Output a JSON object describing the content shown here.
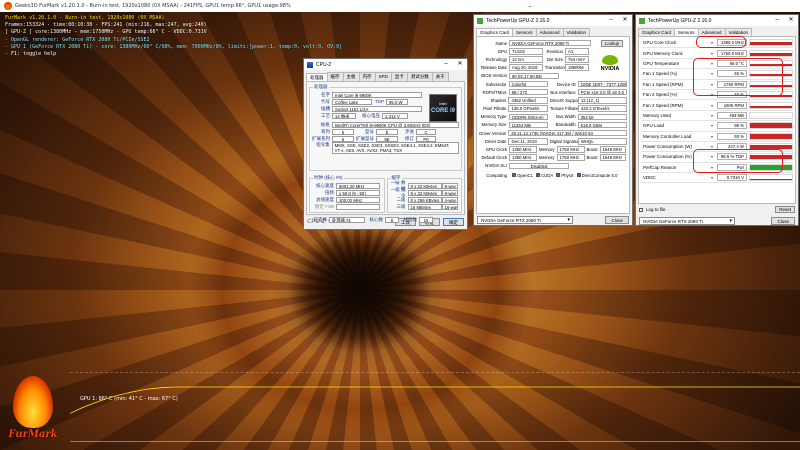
{
  "furmark": {
    "window_title": "Geeks3D FurMark v1.20.1.0 - Burn-in test, 1920x1080 (0X MSAA) - 241FPS, GPU1 temp:66°, GPU1 usage:98%",
    "overlay_line1": "FurMark v1.20.1.0 - Burn-in test, 1920x1080 (0X MSAA)",
    "overlay_line2": "Frames:153324 - time:00:10:38 - FPS:241 (min:216, max:247, avg:240)",
    "overlay_line3": "[ GPU-Z ] core:1380MHz - mem:1750MHz - GPU temp:66° C - VDDC:0.731V",
    "overlay_line4": "- OpenGL renderer: GeForce RTX 2080 Ti/PCIe/SSE2",
    "overlay_line5": "- GPU 1 (GeForce RTX 2080 Ti) - core: 1380MHz/66° C/98%, mem: 7000MHz/8%, limits:[power:1, temp:0, volt:0, OV:0]",
    "overlay_line6": "- F1: toggle help",
    "graph_label": "GPU 1: 66° C (min: 41° C - max: 67° C)",
    "logo_text": "FurMark",
    "temp_min": 41,
    "temp_max": 67,
    "temp_current": 66
  },
  "cpuz": {
    "title": "CPU-Z",
    "tabs": [
      "处理器",
      "缓存",
      "主板",
      "内存",
      "SPD",
      "显卡",
      "测试分数",
      "关于"
    ],
    "group_processor": "处理器",
    "name_label": "名字",
    "name_value": "Intel Core i9 9900K",
    "codename_label": "代号",
    "codename_value": "Coffee Lake",
    "tdp_label": "TDP",
    "tdp_value": "95.0 W",
    "package_label": "插槽",
    "package_value": "Socket 1151 LGA",
    "tech_label": "工艺",
    "tech_value": "14 纳米",
    "voltage_label": "核心电压",
    "voltage_value": "1.312 V",
    "spec_label": "规格",
    "spec_value": "Intel(R) Core(TM) i9-9900K CPU @ 3.60GHz (ES)",
    "family_label": "系列",
    "family_value": "6",
    "model_label": "型号",
    "model_value": "E",
    "stepping_label": "步进",
    "stepping_value": "C",
    "extfamily_label": "扩展系列",
    "extfamily_value": "6",
    "extmodel_label": "扩展型号",
    "extmodel_value": "9E",
    "revision_label": "修订",
    "revision_value": "P0",
    "instr_label": "指令集",
    "instr_value": "MMX, SSE, SSE2, SSE3, SSSE3, SSE4.1, SSE4.2, EM64T, VT-x, AES, AVX, AVX2, FMA3, TSX",
    "clocks_group": "时钟 (核心 #0)",
    "core_speed_label": "核心速度",
    "core_speed_value": "5001.20 MHz",
    "multiplier_label": "倍频",
    "multiplier_value": "x 50.0 (8 - 50)",
    "bus_label": "总线速度",
    "bus_value": "100.02 MHz",
    "fsb_label": "额定 FSB",
    "fsb_value": "",
    "cache_group": "缓存",
    "l1d_label": "一级 数据",
    "l1d_value": "8 x 32 KBytes",
    "l1d_way": "8-way",
    "l1i_label": "一级 指令",
    "l1i_value": "8 x 32 KBytes",
    "l1i_way": "8-way",
    "l2_label": "二级",
    "l2_value": "8 x 256 KBytes",
    "l2_way": "4-way",
    "l3_label": "三级",
    "l3_value": "16 MBytes",
    "l3_way": "16-way",
    "selection_label": "已选择",
    "selection_value": "处理器 #1",
    "cores_label": "核心数",
    "cores_value": "8",
    "threads_label": "线程数",
    "threads_value": "16",
    "brand": "CPU-Z",
    "version": "Ver. 1.87.0.x64",
    "tools_button": "工具",
    "validate_button": "验证",
    "ok_button": "确定",
    "intel_badge_top": "intel",
    "intel_badge_main": "CORE i9"
  },
  "gpuz1": {
    "title": "TechPowerUp GPU-Z 2.16.0",
    "tabs": [
      "Graphics Card",
      "Sensors",
      "Advanced",
      "Validation"
    ],
    "lookup_button": "Lookup",
    "nvidia_text": "NVIDIA",
    "rows": [
      {
        "label": "Name",
        "value": "NVIDIA GeForce RTX 2080 Ti"
      },
      {
        "label": "GPU",
        "value": "TU102",
        "label2": "Revision",
        "value2": "A1"
      },
      {
        "label": "Technology",
        "value": "12 nm",
        "label2": "Die Size",
        "value2": "754 mm²"
      },
      {
        "label": "Release Date",
        "value": "Aug 20, 2018",
        "label2": "Transistors",
        "value2": "18600M"
      },
      {
        "label": "BIOS Version",
        "value": "90.02.17.00.BD"
      },
      {
        "label": "Subvendor",
        "value": "Colorful",
        "label2": "Device ID",
        "value2": "10DE 1E07 - 7377 1208"
      },
      {
        "label": "ROPs/TMUs",
        "value": "88 / 272",
        "label2": "Bus Interface",
        "value2": "PCIe x16 3.0 @ x8 3.0"
      },
      {
        "label": "Shaders",
        "value": "4352 Unified",
        "label2": "DirectX Support",
        "value2": "12 (12_1)"
      },
      {
        "label": "Pixel Fillrate",
        "value": "136.0 GPixel/s",
        "label2": "Texture Fillrate",
        "value2": "420.2 GTexel/s"
      },
      {
        "label": "Memory Type",
        "value": "GDDR6 (Micron)",
        "label2": "Bus Width",
        "value2": "352 bit"
      },
      {
        "label": "Memory Size",
        "value": "11264 MB",
        "label2": "Bandwidth",
        "value2": "616.0 GB/s"
      },
      {
        "label": "Driver Version",
        "value": "25.21.14.1735 (NVIDIA 417.35) / Win10 64"
      },
      {
        "label": "Driver Date",
        "value": "Dec 11, 2018",
        "label2": "Digital Signature",
        "value2": "WHQL"
      },
      {
        "label": "GPU Clock",
        "value": "1350 MHz",
        "label2": "Memory",
        "value2": "1750 MHz",
        "label3": "Boost",
        "value3": "1545 MHz"
      },
      {
        "label": "Default Clock",
        "value": "1350 MHz",
        "label2": "Memory",
        "value2": "1750 MHz",
        "label3": "Boost",
        "value3": "1545 MHz"
      },
      {
        "label": "NVIDIA SLI",
        "value": "Disabled"
      }
    ],
    "computing_label": "Computing",
    "computing_items": [
      "OpenCL",
      "CUDA",
      "PhysX",
      "DirectCompute 5.0"
    ],
    "select_value": "NVIDIA GeForce RTX 2080 Ti",
    "close_button": "Close"
  },
  "gpuz2": {
    "title": "TechPowerUp GPU-Z 2.16.0",
    "tabs": [
      "Graphics Card",
      "Sensors",
      "Advanced",
      "Validation"
    ],
    "sensors": [
      {
        "label": "GPU Core Clock",
        "value": "1380.0 MHz",
        "level": 0.55
      },
      {
        "label": "GPU Memory Clock",
        "value": "1750.0 MHz",
        "level": 0.5
      },
      {
        "label": "GPU Temperature",
        "value": "66.0 °C",
        "level": 0.45
      },
      {
        "label": "Fan 1 Speed (%)",
        "value": "45 %",
        "level": 0.45
      },
      {
        "label": "Fan 1 Speed (RPM)",
        "value": "1750 RPM",
        "level": 0.45
      },
      {
        "label": "Fan 2 Speed (%)",
        "value": "46 %",
        "level": 0.45
      },
      {
        "label": "Fan 2 Speed (RPM)",
        "value": "1605 RPM",
        "level": 0.4
      },
      {
        "label": "Memory Used",
        "value": "493 MB",
        "level": 0.05
      },
      {
        "label": "GPU Load",
        "value": "98 %",
        "level": 0.98
      },
      {
        "label": "Memory Controller Load",
        "value": "93 %",
        "level": 0.93
      },
      {
        "label": "Power Consumption (W)",
        "value": "247.4 W",
        "level": 0.9
      },
      {
        "label": "Power Consumption (%)",
        "value": "98.5 % TDP",
        "level": 0.98
      },
      {
        "label": "PerfCap Reason",
        "value": "Pwr",
        "level": 1.0,
        "green": true
      },
      {
        "label": "VDDC",
        "value": "0.7310 V",
        "level": 0.35
      }
    ],
    "log_label": "Log to file",
    "reset_button": "Reset",
    "select_value": "NVIDIA GeForce RTX 2080 Ti",
    "close_button": "Close"
  },
  "colors": {
    "highlight_red": "#e31b1b",
    "overlay_yellow": "#ffe400",
    "sensor_graph": "#c62828",
    "perfcap_green": "#2aa12a",
    "nvidia_green": "#76b900"
  }
}
